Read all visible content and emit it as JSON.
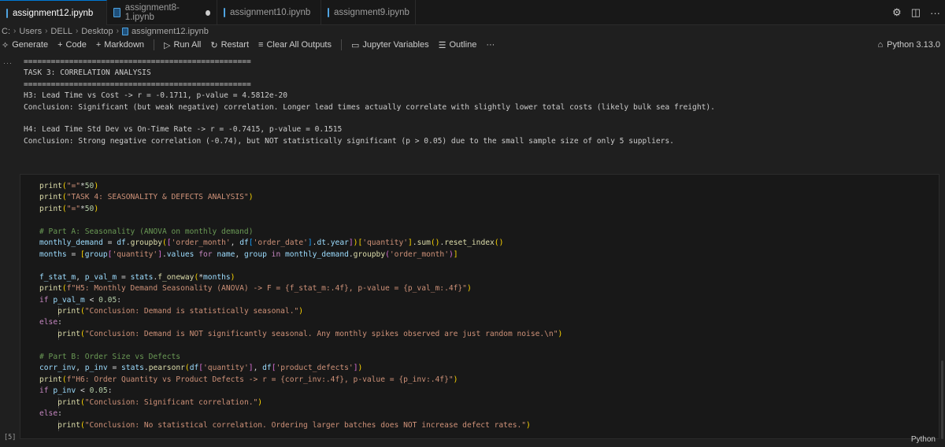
{
  "tabs": [
    {
      "label": "assignment12.ipynb",
      "active": true
    },
    {
      "label": "assignment8-1.ipynb",
      "active": false
    },
    {
      "label": "assignment10.ipynb",
      "active": false
    },
    {
      "label": "assignment9.ipynb",
      "active": false
    }
  ],
  "tab_actions": {
    "settings": "⚙",
    "split": "◫",
    "more": "···"
  },
  "breadcrumb": [
    "C:",
    "Users",
    "DELL",
    "Desktop",
    "assignment12.ipynb"
  ],
  "toolbar": {
    "generate": "Generate",
    "code": "Code",
    "markdown": "Markdown",
    "run_all": "Run All",
    "restart": "Restart",
    "clear_outputs": "Clear All Outputs",
    "variables": "Jupyter Variables",
    "outline": "Outline",
    "more": "···",
    "kernel": "Python 3.13.0"
  },
  "output": {
    "more": "···",
    "lines": [
      "==================================================",
      "TASK 3: CORRELATION ANALYSIS",
      "==================================================",
      "H3: Lead Time vs Cost -> r = -0.1711, p-value = 4.5812e-20",
      "Conclusion: Significant (but weak negative) correlation. Longer lead times actually correlate with slightly lower total costs (likely bulk sea freight).",
      "",
      "H4: Lead Time Std Dev vs On-Time Rate -> r = -0.7415, p-value = 0.1515",
      "Conclusion: Strong negative correlation (-0.74), but NOT statistically significant (p > 0.05) due to the small sample size of only 5 suppliers."
    ]
  },
  "cell": {
    "execution_count": "[5]",
    "language": "Python",
    "code_lines": [
      "print(\"=\"*50)",
      "print(\"TASK 4: SEASONALITY & DEFECTS ANALYSIS\")",
      "print(\"=\"*50)",
      "",
      "# Part A: Seasonality (ANOVA on monthly demand)",
      "monthly_demand = df.groupby(['order_month', df['order_date'].dt.year])['quantity'].sum().reset_index()",
      "months = [group['quantity'].values for name, group in monthly_demand.groupby('order_month')]",
      "",
      "f_stat_m, p_val_m = stats.f_oneway(*months)",
      "print(f\"H5: Monthly Demand Seasonality (ANOVA) -> F = {f_stat_m:.4f}, p-value = {p_val_m:.4f}\")",
      "if p_val_m < 0.05:",
      "    print(\"Conclusion: Demand is statistically seasonal.\")",
      "else:",
      "    print(\"Conclusion: Demand is NOT significantly seasonal. Any monthly spikes observed are just random noise.\\n\")",
      "",
      "# Part B: Order Size vs Defects",
      "corr_inv, p_inv = stats.pearsonr(df['quantity'], df['product_defects'])",
      "print(f\"H6: Order Quantity vs Product Defects -> r = {corr_inv:.4f}, p-value = {p_inv:.4f}\")",
      "if p_inv < 0.05:",
      "    print(\"Conclusion: Significant correlation.\")",
      "else:",
      "    print(\"Conclusion: No statistical correlation. Ordering larger batches does NOT increase defect rates.\")"
    ]
  }
}
